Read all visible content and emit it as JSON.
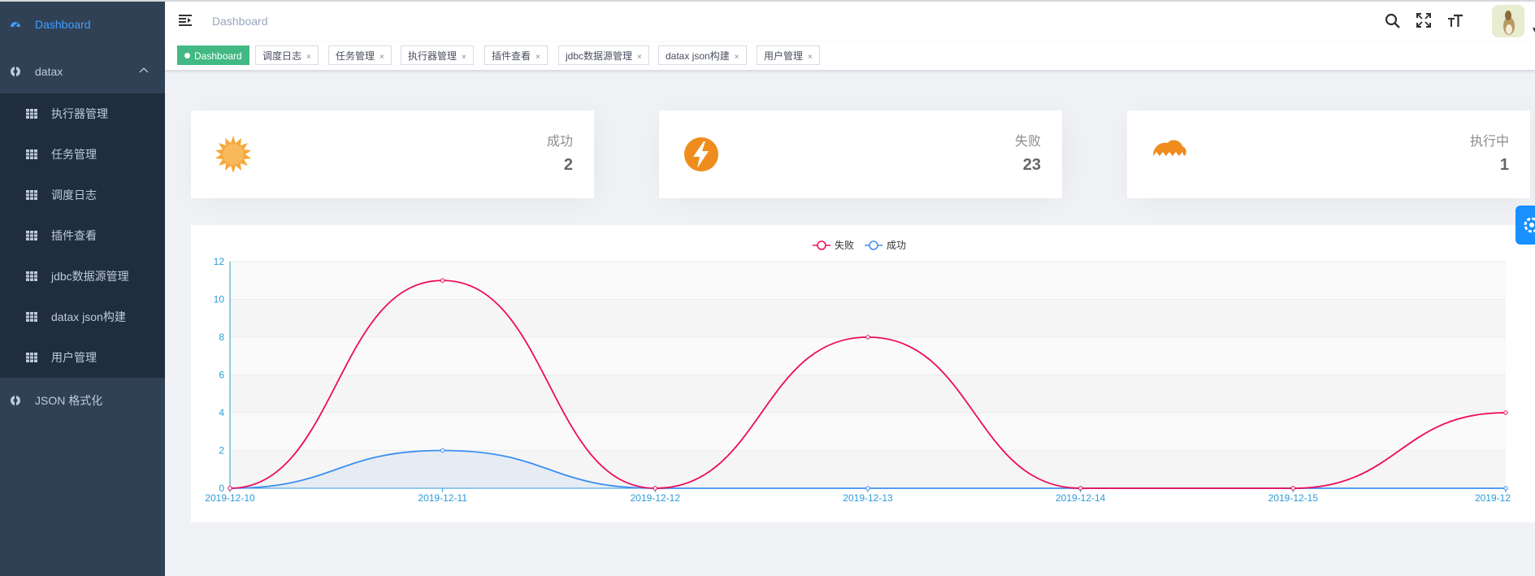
{
  "sidebar": {
    "items": [
      {
        "label": "Dashboard",
        "icon": "dashboard-icon",
        "active": true
      },
      {
        "label": "datax",
        "icon": "component-icon",
        "expanded": true
      },
      {
        "label": "JSON 格式化",
        "icon": "component-icon"
      }
    ],
    "submenu": [
      {
        "label": "执行器管理",
        "icon": "table-icon"
      },
      {
        "label": "任务管理",
        "icon": "table-icon"
      },
      {
        "label": "调度日志",
        "icon": "table-icon"
      },
      {
        "label": "插件查看",
        "icon": "table-icon"
      },
      {
        "label": "jdbc数据源管理",
        "icon": "table-icon"
      },
      {
        "label": "datax json构建",
        "icon": "table-icon"
      },
      {
        "label": "用户管理",
        "icon": "table-icon"
      }
    ]
  },
  "navbar": {
    "breadcrumb": "Dashboard",
    "icons": [
      "search-icon",
      "fullscreen-icon",
      "font-size-icon"
    ]
  },
  "tags": [
    {
      "label": "Dashboard",
      "active": true
    },
    {
      "label": "调度日志"
    },
    {
      "label": "任务管理"
    },
    {
      "label": "执行器管理"
    },
    {
      "label": "插件查看"
    },
    {
      "label": "jdbc数据源管理"
    },
    {
      "label": "datax json构建"
    },
    {
      "label": "用户管理"
    }
  ],
  "tag_close": "×",
  "cards": [
    {
      "title": "成功",
      "value": "2",
      "icon": "sun-icon",
      "color": "#f4a533"
    },
    {
      "title": "失败",
      "value": "23",
      "icon": "lightning-icon",
      "color": "#ef8c1d"
    },
    {
      "title": "执行中",
      "value": "1",
      "icon": "cloud-icon",
      "color": "#ef8c1d"
    }
  ],
  "colors": {
    "sidebar_bg": "#304156",
    "submenu_bg": "#1f2d3d",
    "active": "#409eff",
    "tag_active": "#42b983",
    "fail_line": "#ee0a5a",
    "success_line": "#3b8ff0",
    "axis": "#2c9bd6"
  },
  "chart_data": {
    "type": "line",
    "x": [
      "2019-12-10",
      "2019-12-11",
      "2019-12-12",
      "2019-12-13",
      "2019-12-14",
      "2019-12-15",
      "2019-12-16"
    ],
    "x_tick_labels": [
      "2019-12-10",
      "2019-12-11",
      "2019-12-12",
      "2019-12-13",
      "2019-12-14",
      "2019-12-15",
      "2019-12"
    ],
    "series": [
      {
        "name": "失败",
        "values": [
          0,
          11,
          0,
          8,
          0,
          0,
          4
        ],
        "color": "#ee0a5a"
      },
      {
        "name": "成功",
        "values": [
          0,
          2,
          0,
          0,
          0,
          0,
          0
        ],
        "color": "#3b8ff0"
      }
    ],
    "ylim": [
      0,
      12
    ],
    "yticks": [
      0,
      2,
      4,
      6,
      8,
      10,
      12
    ],
    "smooth": true,
    "grid": "horizontal banded",
    "legend": "top-center"
  }
}
